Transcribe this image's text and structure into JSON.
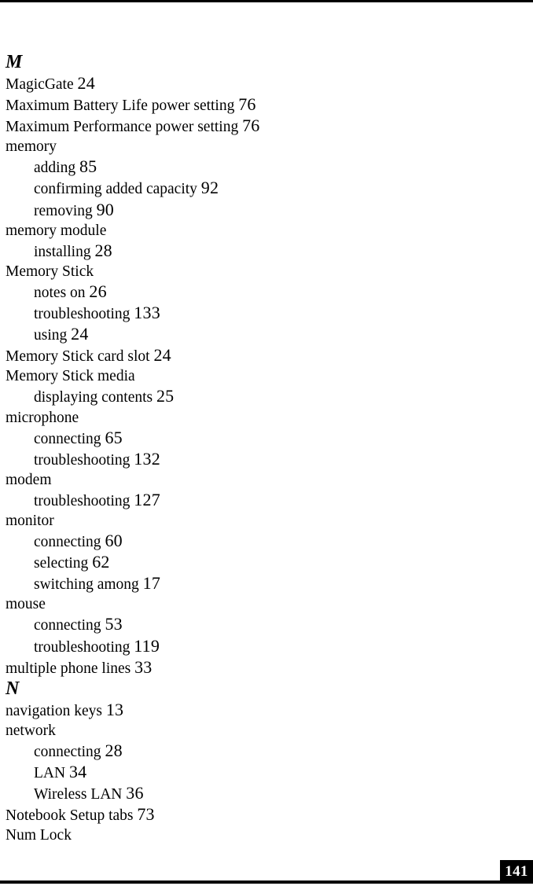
{
  "document": {
    "type": "index",
    "page_number": "141"
  },
  "sections": [
    {
      "letter": "M",
      "entries": [
        {
          "level": 1,
          "term": "MagicGate",
          "page": "24"
        },
        {
          "level": 1,
          "term": "Maximum Battery Life power setting",
          "page": "76"
        },
        {
          "level": 1,
          "term": "Maximum Performance power setting",
          "page": "76"
        },
        {
          "level": 1,
          "term": "memory",
          "page": ""
        },
        {
          "level": 2,
          "term": "adding",
          "page": "85"
        },
        {
          "level": 2,
          "term": "confirming added capacity",
          "page": "92"
        },
        {
          "level": 2,
          "term": "removing",
          "page": "90"
        },
        {
          "level": 1,
          "term": "memory module",
          "page": ""
        },
        {
          "level": 2,
          "term": "installing",
          "page": "28"
        },
        {
          "level": 1,
          "term": "Memory Stick",
          "page": ""
        },
        {
          "level": 2,
          "term": "notes on",
          "page": "26"
        },
        {
          "level": 2,
          "term": "troubleshooting",
          "page": "133"
        },
        {
          "level": 2,
          "term": "using",
          "page": "24"
        },
        {
          "level": 1,
          "term": "Memory Stick card slot",
          "page": "24"
        },
        {
          "level": 1,
          "term": "Memory Stick media",
          "page": ""
        },
        {
          "level": 2,
          "term": "displaying contents",
          "page": "25"
        },
        {
          "level": 1,
          "term": "microphone",
          "page": ""
        },
        {
          "level": 2,
          "term": "connecting",
          "page": "65"
        },
        {
          "level": 2,
          "term": "troubleshooting",
          "page": "132"
        },
        {
          "level": 1,
          "term": "modem",
          "page": ""
        },
        {
          "level": 2,
          "term": "troubleshooting",
          "page": "127"
        },
        {
          "level": 1,
          "term": "monitor",
          "page": ""
        },
        {
          "level": 2,
          "term": "connecting",
          "page": "60"
        },
        {
          "level": 2,
          "term": "selecting",
          "page": "62"
        },
        {
          "level": 2,
          "term": "switching among",
          "page": "17"
        },
        {
          "level": 1,
          "term": "mouse",
          "page": ""
        },
        {
          "level": 2,
          "term": "connecting",
          "page": "53"
        },
        {
          "level": 2,
          "term": "troubleshooting",
          "page": "119"
        },
        {
          "level": 1,
          "term": "multiple phone lines",
          "page": "33"
        }
      ]
    },
    {
      "letter": "N",
      "entries": [
        {
          "level": 1,
          "term": "navigation keys",
          "page": "13"
        },
        {
          "level": 1,
          "term": "network",
          "page": ""
        },
        {
          "level": 2,
          "term": "connecting",
          "page": "28"
        },
        {
          "level": 2,
          "term": "LAN",
          "page": "34"
        },
        {
          "level": 2,
          "term": "Wireless LAN",
          "page": "36"
        },
        {
          "level": 1,
          "term": "Notebook Setup tabs",
          "page": "73"
        },
        {
          "level": 1,
          "term": "Num Lock",
          "page": ""
        }
      ]
    }
  ]
}
